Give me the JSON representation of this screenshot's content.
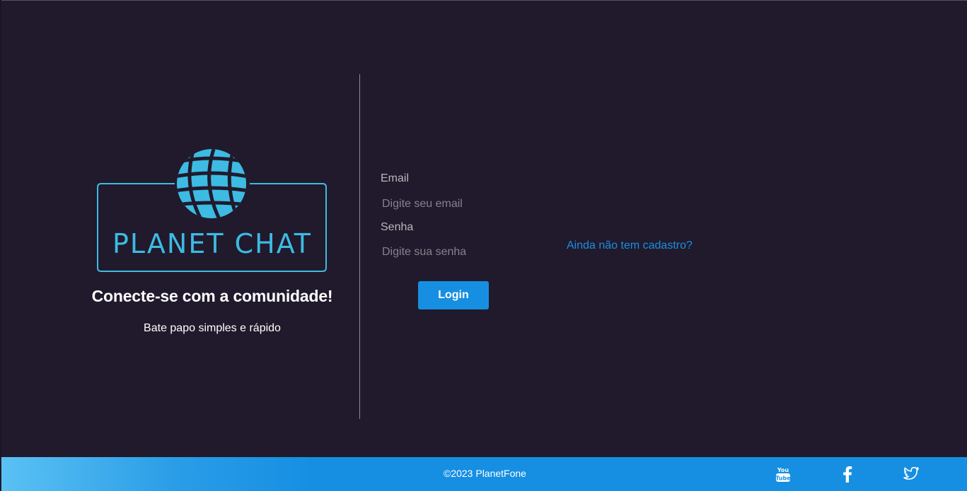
{
  "brand": {
    "logo_text": "PLANET CHAT",
    "tagline": "Conecte-se com a comunidade!",
    "subtagline": "Bate papo simples e rápido",
    "accent_color": "#3dbbe3"
  },
  "form": {
    "email": {
      "label": "Email",
      "placeholder": "Digite seu email",
      "value": ""
    },
    "password": {
      "label": "Senha",
      "placeholder": "Digite sua senha",
      "value": ""
    },
    "login_label": "Login",
    "register_link": "Ainda não tem cadastro?",
    "button_color": "#168fe3",
    "link_color": "#1a8ee3"
  },
  "footer": {
    "copyright": "©2023 PlanetFone",
    "social_icons": [
      "youtube-icon",
      "facebook-icon",
      "twitter-icon"
    ]
  },
  "colors": {
    "background": "#201a2c",
    "footer": "#168fe3"
  }
}
